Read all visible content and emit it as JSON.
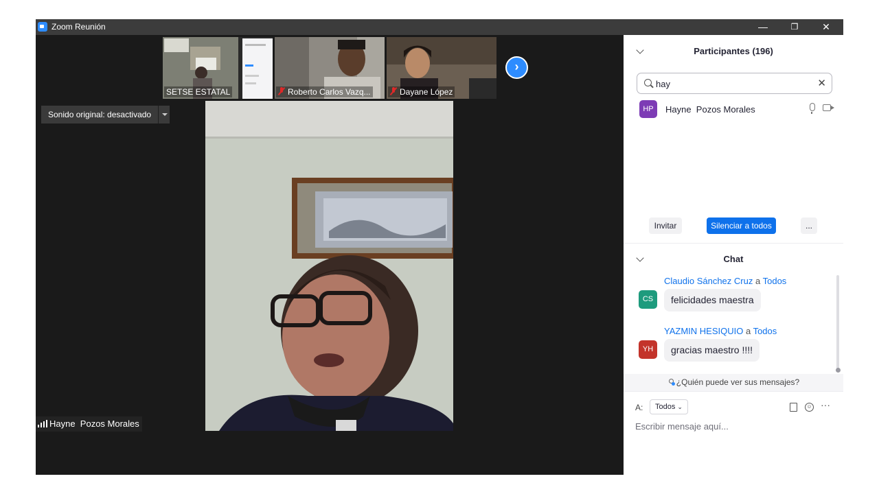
{
  "window": {
    "title": "Zoom Reunión"
  },
  "titlebar": {
    "minimize_glyph": "—",
    "restore_glyph": "❐",
    "close_glyph": "✕"
  },
  "thumbnails": [
    {
      "name": "SETSE ESTATAL",
      "muted": false
    },
    {
      "name": "Roberto Carlos Vazq...",
      "muted": true
    },
    {
      "name": "Dayane López",
      "muted": true
    }
  ],
  "stage": {
    "original_sound_label": "Sonido original: desactivado",
    "speaker_name": "Hayne  Pozos Morales",
    "next_page_glyph": "›"
  },
  "participants": {
    "title": "Participantes (196)",
    "search_value": "hay",
    "clear_glyph": "✕",
    "list": [
      {
        "initials": "HP",
        "name": "Hayne  Pozos Morales",
        "avatar_color": "#7d3cb5"
      }
    ],
    "invite_label": "Invitar",
    "mute_all_label": "Silenciar a todos",
    "more_label": "..."
  },
  "chat": {
    "title": "Chat",
    "messages": [
      {
        "initials": "CS",
        "sender": "Claudio Sánchez Cruz",
        "to_word": "a",
        "recipient": "Todos",
        "text": "felicidades maestra",
        "avatar_color": "#1e9b7d"
      },
      {
        "initials": "YH",
        "sender": "YAZMIN HESIQUIO",
        "to_word": "a",
        "recipient": "Todos",
        "text": "gracias maestro !!!!",
        "avatar_color": "#c3342b"
      }
    ],
    "who_can_see": "¿Quién puede ver sus mensajes?",
    "to_label": "A:",
    "to_value": "Todos",
    "more_glyph": "···",
    "compose_placeholder": "Escribir mensaje aquí..."
  },
  "colors": {
    "accent": "#0e71eb",
    "zoom_blue": "#2d8cff",
    "dark_bg": "#1a1a1a"
  }
}
